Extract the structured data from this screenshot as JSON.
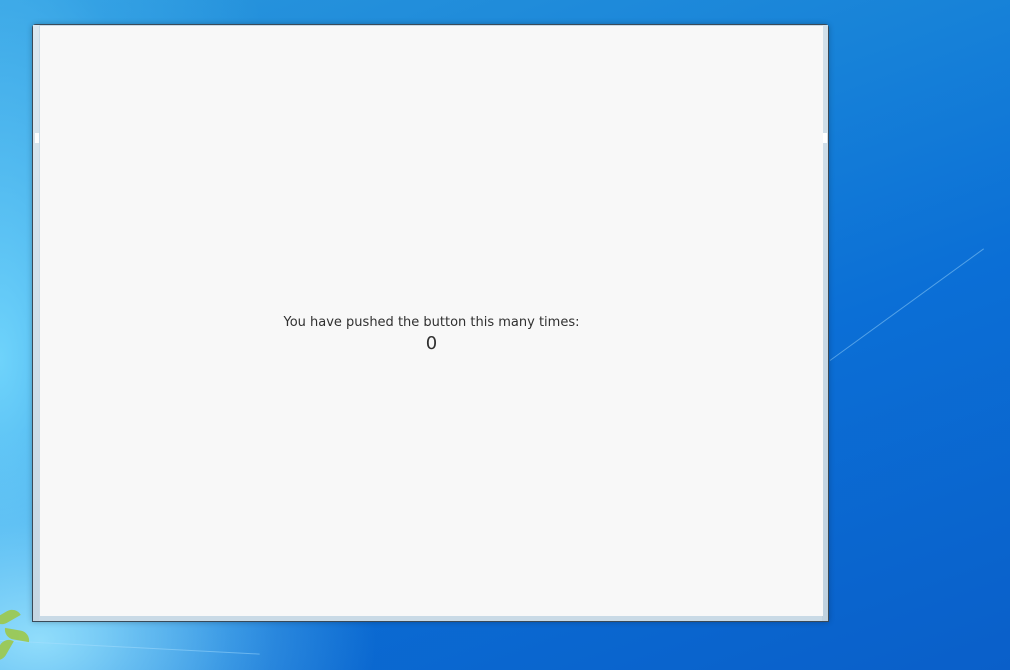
{
  "desktop": {
    "background_colors": [
      "#2a97dd",
      "#0b6fd6",
      "#0a5fc9"
    ]
  },
  "window": {
    "client_background": "#f8f8f8",
    "frame_color": "#c9dae6",
    "message": "You have pushed the button this many times:",
    "counter": "0"
  }
}
